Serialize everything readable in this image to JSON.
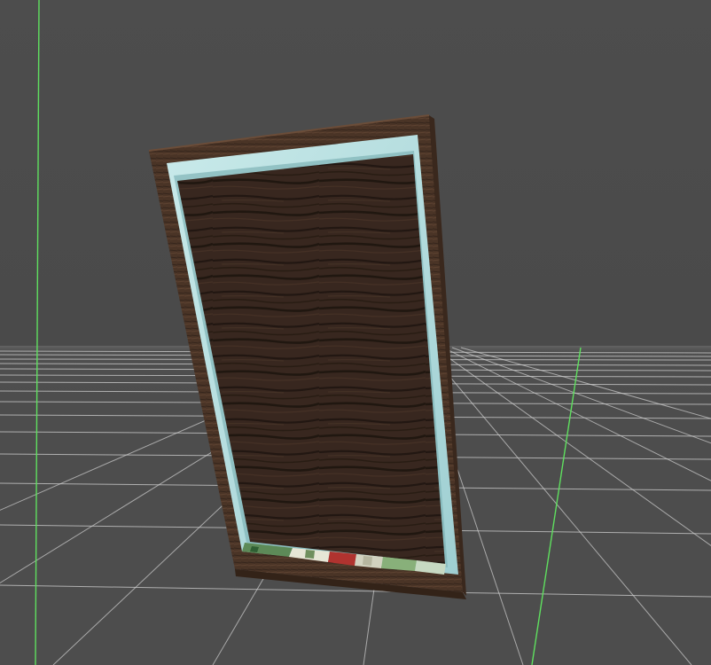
{
  "viewport": {
    "background_color": "#4b4b4b",
    "floor_color": "#4f4f4f",
    "grid_line_color": "#d9d9d9",
    "axis_line_color": "#5fe05f"
  },
  "object": {
    "type": "wooden-picture-frame",
    "frame_color": "#4a3426",
    "frame_dark_color": "#2e2018",
    "glass_color": "#b9e0e0",
    "panel_color": "#3d2b22",
    "grain_color": "#1f1510",
    "photo_strip_colors": [
      "#5d8a58",
      "#e6e6d6",
      "#b0332f",
      "#88b07a",
      "#d2d2c0"
    ]
  }
}
